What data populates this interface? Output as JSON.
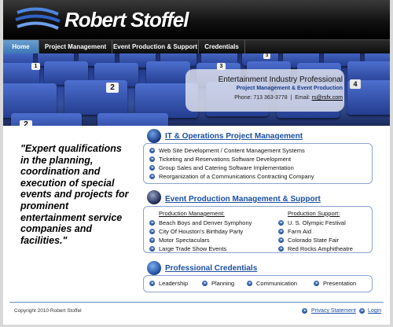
{
  "header": {
    "logo_text": "Robert Stoffel"
  },
  "nav": [
    {
      "label": "Home"
    },
    {
      "label": "Project Management"
    },
    {
      "label": "Event Production & Support"
    },
    {
      "label": "Credentials"
    }
  ],
  "banner": {
    "seat_numbers": [
      "1",
      "3",
      "3",
      "2",
      "2",
      "4"
    ],
    "title": "Entertainment Industry Professional",
    "subtitle": "Project Management & Event Production",
    "phone": "Phone: 713 363-3778",
    "email_label": "Email:",
    "email": "rs@rsfx.com"
  },
  "quote": "\"Expert qualifications in the planning, coordination and execution of special events and projects for prominent entertainment service companies and facilities.\"",
  "sections": {
    "it": {
      "title": "IT & Operations Project Management",
      "items": [
        "Web Site Development / Content Management Systems",
        "Ticketing and Reservations Software Development",
        "Group Sales and Catering Software Implementation",
        "Reorganization of a Communications Contracting Company"
      ]
    },
    "event": {
      "title": "Event Production Management & Support",
      "production_management": {
        "heading": "Production Management:",
        "items": [
          "Beach Boys and Denver Symphony",
          "City Of Houston's Birthday Party",
          "Motor Spectaculars",
          "Large Trade Show Events"
        ]
      },
      "production_support": {
        "heading": "Production Support:",
        "items": [
          "U. S. Olympic Festival",
          "Farm Aid",
          "Colorado State Fair",
          "Red Rocks Amphitheatre"
        ]
      }
    },
    "credentials": {
      "title": "Professional Credentials",
      "items": [
        "Leadership",
        "Planning",
        "Communication",
        "Presentation"
      ]
    }
  },
  "footer": {
    "copyright": "Copyright 2010 Robert Stoffel",
    "privacy": "Privacy Statement",
    "login": "Login"
  }
}
